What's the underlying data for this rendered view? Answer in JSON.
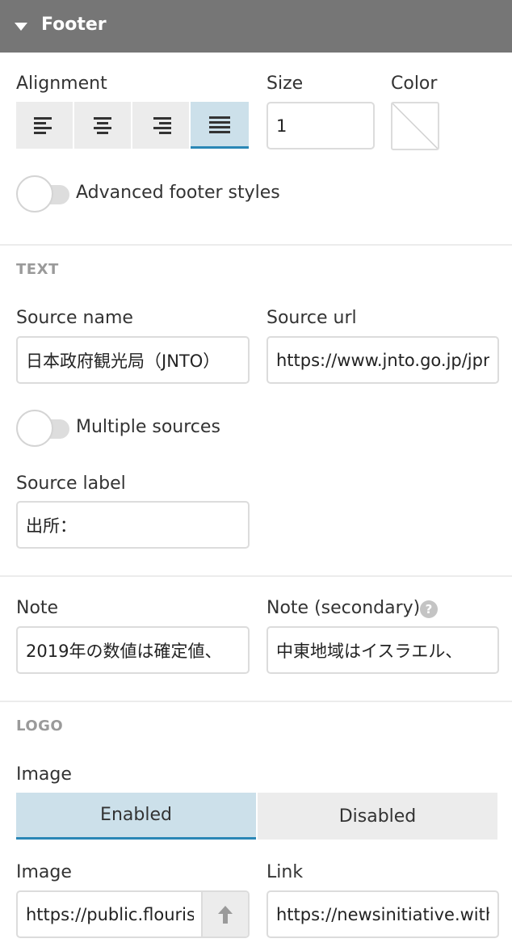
{
  "header": {
    "title": "Footer"
  },
  "footer_top": {
    "alignment_label": "Alignment",
    "size_label": "Size",
    "size_value": "1",
    "color_label": "Color",
    "alignment_options": [
      "left",
      "center",
      "right",
      "justify"
    ],
    "alignment_selected": "justify",
    "advanced_label": "Advanced footer styles"
  },
  "text": {
    "section_title": "TEXT",
    "source_name_label": "Source name",
    "source_name_value": "日本政府観光局（JNTO）",
    "source_url_label": "Source url",
    "source_url_value": "https://www.jnto.go.jp/jpn/statistics/",
    "multiple_sources_label": "Multiple sources",
    "source_label_label": "Source label",
    "source_label_value": "出所："
  },
  "notes": {
    "note_label": "Note",
    "note_value": "2019年の数値は確定値、",
    "note_secondary_label": "Note (secondary)",
    "help_glyph": "?",
    "note_secondary_value": "中東地域はイスラエル、"
  },
  "logo": {
    "section_title": "LOGO",
    "image_toggle_label": "Image",
    "enabled_label": "Enabled",
    "disabled_label": "Disabled",
    "image_label": "Image",
    "image_value": "https://public.flourish.studio/",
    "link_label": "Link",
    "link_value": "https://newsinitiative.withgoogle.com/"
  },
  "colors": {
    "accent": "#2a87b6",
    "active_bg": "#cce0ea",
    "header_bg": "#767676"
  }
}
